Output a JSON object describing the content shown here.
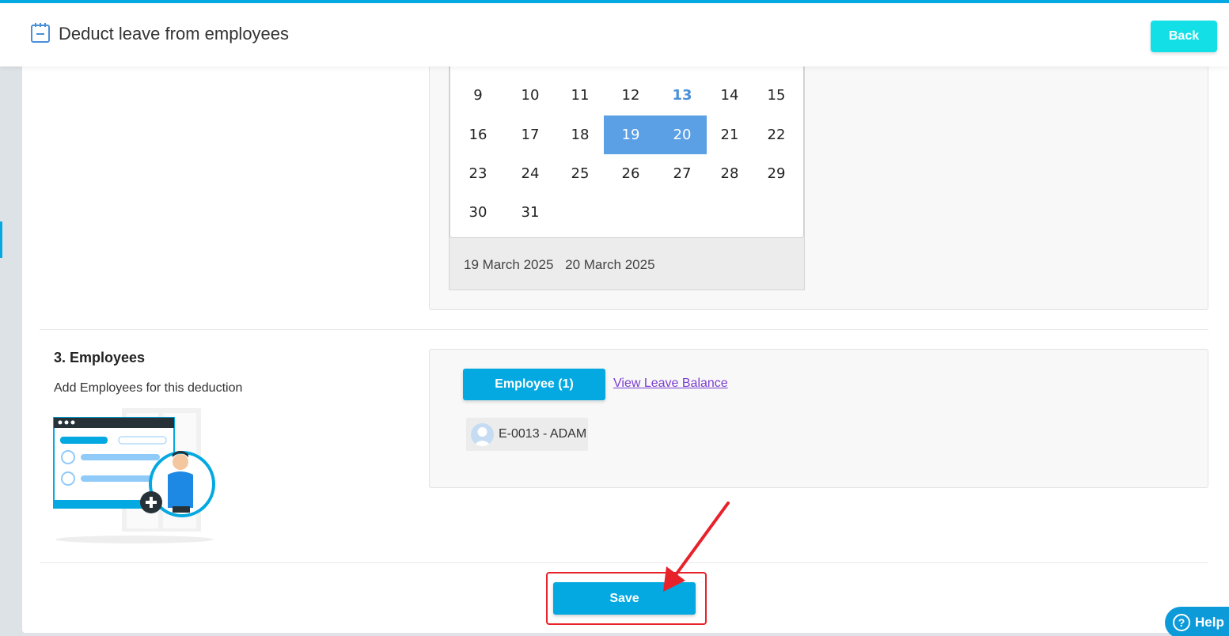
{
  "header": {
    "title": "Deduct leave from employees",
    "back_label": "Back",
    "accent_color": "#03a9e0"
  },
  "calendar": {
    "rows": [
      [
        "9",
        "10",
        "11",
        "12",
        "13",
        "14",
        "15"
      ],
      [
        "16",
        "17",
        "18",
        "19",
        "20",
        "21",
        "22"
      ],
      [
        "23",
        "24",
        "25",
        "26",
        "27",
        "28",
        "29"
      ],
      [
        "30",
        "31",
        "",
        "",
        "",
        "",
        ""
      ]
    ],
    "today": "13",
    "selected": [
      "19",
      "20"
    ],
    "selected_dates": [
      "19 March 2025",
      "20 March 2025"
    ]
  },
  "employees_section": {
    "title": "3. Employees",
    "description": "Add Employees for this deduction",
    "employee_button_label": "Employee (1)",
    "view_balance_link": "View Leave Balance",
    "employees": [
      {
        "label": "E-0013 - ADAM"
      }
    ]
  },
  "actions": {
    "save_label": "Save"
  },
  "help": {
    "label": "Help"
  }
}
